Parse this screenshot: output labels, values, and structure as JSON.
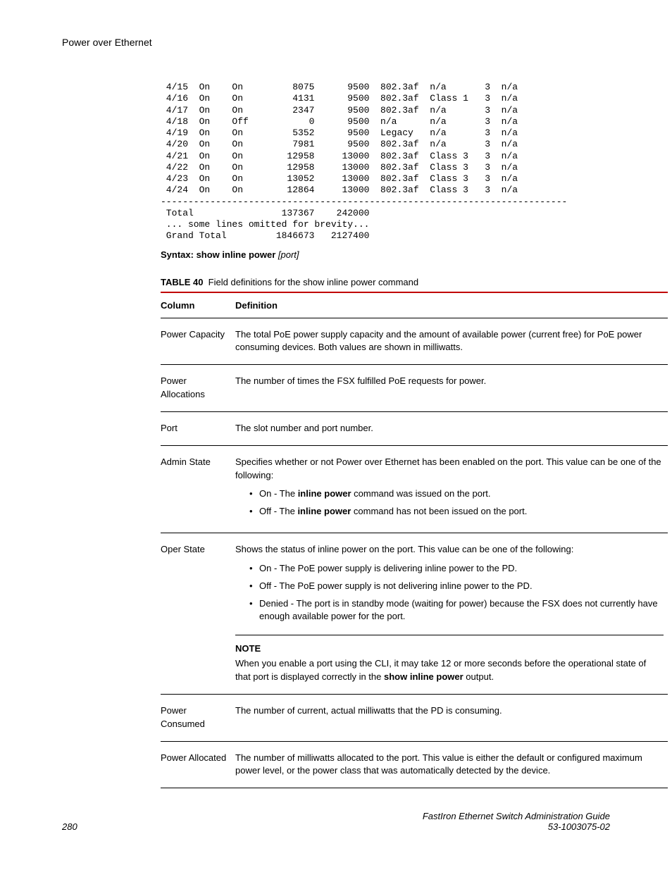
{
  "header": {
    "title": "Power over Ethernet"
  },
  "cli": {
    "rows": [
      {
        "port": "4/15",
        "admin": "On",
        "oper": "On",
        "cons": "8075",
        "alloc": "9500",
        "type": "802.3af",
        "cls": "n/a",
        "pri": "3",
        "fault": "n/a"
      },
      {
        "port": "4/16",
        "admin": "On",
        "oper": "On",
        "cons": "4131",
        "alloc": "9500",
        "type": "802.3af",
        "cls": "Class 1",
        "pri": "3",
        "fault": "n/a"
      },
      {
        "port": "4/17",
        "admin": "On",
        "oper": "On",
        "cons": "2347",
        "alloc": "9500",
        "type": "802.3af",
        "cls": "n/a",
        "pri": "3",
        "fault": "n/a"
      },
      {
        "port": "4/18",
        "admin": "On",
        "oper": "Off",
        "cons": "0",
        "alloc": "9500",
        "type": "n/a",
        "cls": "n/a",
        "pri": "3",
        "fault": "n/a"
      },
      {
        "port": "4/19",
        "admin": "On",
        "oper": "On",
        "cons": "5352",
        "alloc": "9500",
        "type": "Legacy",
        "cls": "n/a",
        "pri": "3",
        "fault": "n/a"
      },
      {
        "port": "4/20",
        "admin": "On",
        "oper": "On",
        "cons": "7981",
        "alloc": "9500",
        "type": "802.3af",
        "cls": "n/a",
        "pri": "3",
        "fault": "n/a"
      },
      {
        "port": "4/21",
        "admin": "On",
        "oper": "On",
        "cons": "12958",
        "alloc": "13000",
        "type": "802.3af",
        "cls": "Class 3",
        "pri": "3",
        "fault": "n/a"
      },
      {
        "port": "4/22",
        "admin": "On",
        "oper": "On",
        "cons": "12958",
        "alloc": "13000",
        "type": "802.3af",
        "cls": "Class 3",
        "pri": "3",
        "fault": "n/a"
      },
      {
        "port": "4/23",
        "admin": "On",
        "oper": "On",
        "cons": "13052",
        "alloc": "13000",
        "type": "802.3af",
        "cls": "Class 3",
        "pri": "3",
        "fault": "n/a"
      },
      {
        "port": "4/24",
        "admin": "On",
        "oper": "On",
        "cons": "12864",
        "alloc": "13000",
        "type": "802.3af",
        "cls": "Class 3",
        "pri": "3",
        "fault": "n/a"
      }
    ],
    "sep": "--------------------------------------------------------------------------",
    "total_label": "Total",
    "total_cons": "137367",
    "total_alloc": "242000",
    "omit": "... some lines omitted for brevity...",
    "grand_label": "Grand Total",
    "grand_cons": "1846673",
    "grand_alloc": "2127400"
  },
  "syntax": {
    "prefix": "Syntax: show inline power",
    "arg": "[port]"
  },
  "table_caption": {
    "num": "TABLE 40",
    "title": "Field definitions for the show inline power command"
  },
  "table": {
    "headers": {
      "col1": "Column",
      "col2": "Definition"
    },
    "rows": [
      {
        "col1": "Power Capacity",
        "text": "The total PoE power supply capacity and the amount of available power (current free) for PoE power consuming devices. Both values are shown in milliwatts."
      },
      {
        "col1": "Power Allocations",
        "text": "The number of times the FSX fulfilled PoE requests for power."
      },
      {
        "col1": "Port",
        "text": "The slot number and port number."
      },
      {
        "col1": "Admin State",
        "text": "Specifies whether or not Power over Ethernet has been enabled on the port. This value can be one of the following:",
        "bullets": [
          {
            "pre": "On - The ",
            "bold": "inline power",
            "post": " command was issued on the port."
          },
          {
            "pre": "Off - The ",
            "bold": "inline power",
            "post": " command has not been issued on the port."
          }
        ]
      },
      {
        "col1": "Oper State",
        "text": "Shows the status of inline power on the port. This value can be one of the following:",
        "plain_bullets": [
          "On - The PoE power supply is delivering inline power to the PD.",
          "Off - The PoE power supply is not delivering inline power to the PD.",
          "Denied - The port is in standby mode (waiting for power) because the FSX does not currently have enough available power for the port."
        ],
        "note": {
          "label": "NOTE",
          "pre": "When you enable a port using the CLI, it may take 12 or more seconds before the operational state of that port is displayed correctly in the ",
          "bold": "show inline power",
          "post": " output."
        }
      },
      {
        "col1": "Power Consumed",
        "text": "The number of current, actual milliwatts that the PD is consuming."
      },
      {
        "col1": "Power Allocated",
        "text": "The number of milliwatts allocated to the port. This value is either the default or configured maximum power level, or the power class that was automatically detected by the device."
      }
    ]
  },
  "footer": {
    "page": "280",
    "doc": "FastIron Ethernet Switch Administration Guide",
    "docnum": "53-1003075-02"
  }
}
